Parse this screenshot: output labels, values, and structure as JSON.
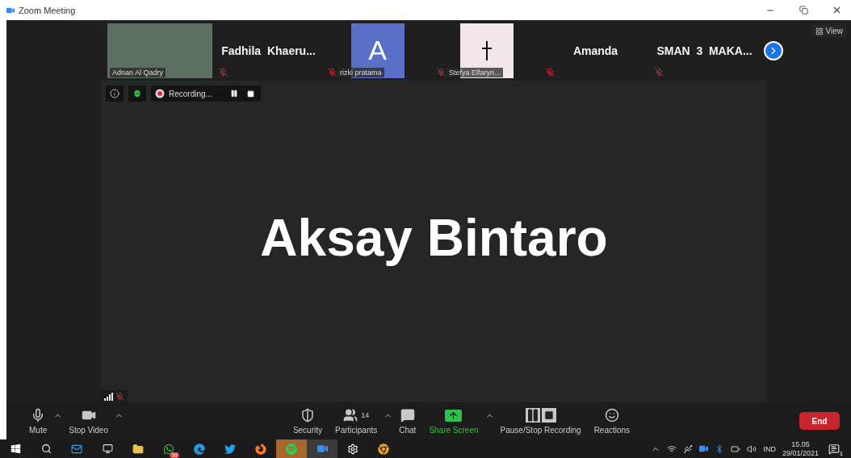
{
  "window": {
    "title": "Zoom Meeting"
  },
  "view_button": {
    "label": "View"
  },
  "participants": [
    {
      "kind": "video",
      "name": "Adnan Al Qadry",
      "muted": false
    },
    {
      "kind": "name",
      "name": "Fadhila  Khaeru...",
      "muted": true
    },
    {
      "kind": "avatar",
      "letter": "A",
      "name": "rizki pratama",
      "muted": true
    },
    {
      "kind": "image",
      "name": "Stefya Elfaryn...",
      "muted": true
    },
    {
      "kind": "name",
      "name": "Amanda",
      "muted": true
    },
    {
      "kind": "name",
      "name": "SMAN  3  MAKA...",
      "muted": true
    }
  ],
  "recording": {
    "label": "Recording..."
  },
  "speaker": {
    "name": "Aksay Bintaro",
    "muted": true
  },
  "controls": [
    {
      "kind": "mic",
      "label": "Mute",
      "caret": true
    },
    {
      "kind": "video",
      "label": "Stop Video",
      "caret": true
    },
    {
      "kind": "spacer"
    },
    {
      "kind": "security",
      "label": "Security",
      "caret": false
    },
    {
      "kind": "participants",
      "label": "Participants",
      "count": "14",
      "caret": true
    },
    {
      "kind": "chat",
      "label": "Chat",
      "caret": false
    },
    {
      "kind": "share",
      "label": "Share Screen",
      "caret": true
    },
    {
      "kind": "record",
      "label": "Pause/Stop Recording",
      "caret": false
    },
    {
      "kind": "reactions",
      "label": "Reactions",
      "caret": false
    }
  ],
  "end_button": {
    "label": "End"
  },
  "taskbar": {
    "apps": [
      {
        "kind": "start",
        "active": false,
        "attention": false
      },
      {
        "kind": "search",
        "active": false,
        "attention": false
      },
      {
        "kind": "mail",
        "active": false,
        "attention": false
      },
      {
        "kind": "editor",
        "active": false,
        "attention": false
      },
      {
        "kind": "folder",
        "active": false,
        "attention": false
      },
      {
        "kind": "whatsapp",
        "badge": "99",
        "active": false,
        "attention": false
      },
      {
        "kind": "edge",
        "active": false,
        "attention": false
      },
      {
        "kind": "twitter",
        "active": false,
        "attention": false
      },
      {
        "kind": "firefox",
        "active": false,
        "attention": false
      },
      {
        "kind": "spotify",
        "active": false,
        "attention": true
      },
      {
        "kind": "zoom",
        "active": true,
        "attention": false
      },
      {
        "kind": "settings",
        "active": false,
        "attention": false
      },
      {
        "kind": "chrome",
        "active": false,
        "attention": false
      }
    ],
    "tray": {
      "language": "IND",
      "time": "15.05",
      "date": "29/01/2021",
      "notifications": "1"
    }
  }
}
